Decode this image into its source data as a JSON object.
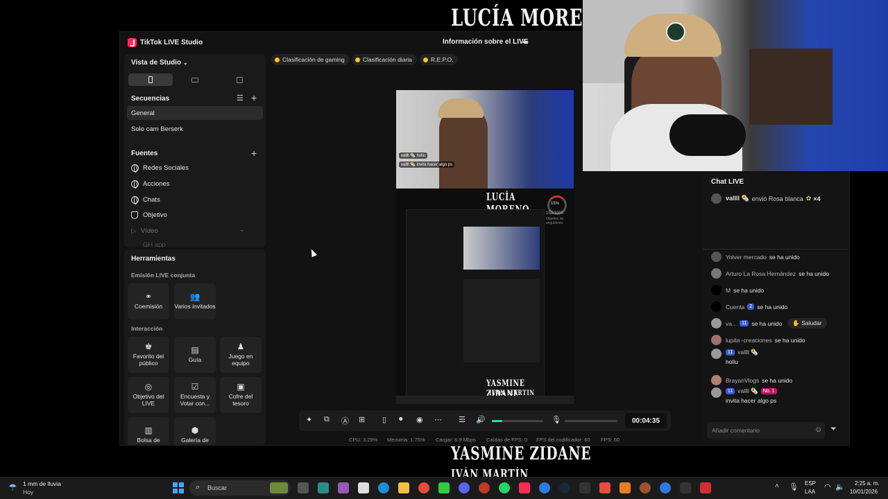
{
  "overlay": {
    "top_name": "LUCÍA MORENO",
    "bottom_name": "YASMINE ZIDANE",
    "bottom_name_2": "IVÁN MARTÍN"
  },
  "window": {
    "app_title": "TikTok LIVE Studio",
    "live_info": "Información sobre el LIVE"
  },
  "studio_view": {
    "label": "Vista de Studio"
  },
  "sequences": {
    "title": "Secuencias",
    "items": [
      "General",
      "Solo cam Berserk"
    ]
  },
  "sources": {
    "title": "Fuentes",
    "items": [
      "Redes Sociales",
      "Acciones",
      "Chats",
      "Objetivo",
      "Vídeo",
      "GH app"
    ]
  },
  "tools": {
    "title": "Herramientas",
    "section_joint": "Emisión LIVE conjunta",
    "joint_items": [
      "Coemisión",
      "Varios invitados"
    ],
    "section_interaction": "Interacción",
    "interaction_items": [
      "Favorito del público",
      "Guía",
      "Juego en equipo",
      "Objetivo del LIVE",
      "Encuesta y Votar con...",
      "Cofre del tesoro",
      "Bolsa de",
      "Galería de"
    ]
  },
  "tags": [
    "Clasificación de gaming",
    "Clasificación diaria",
    "R.E.P.O."
  ],
  "preview": {
    "top_name": "LUCÍA MORENO",
    "goal_percent": "15%",
    "goal_count": "153/1000",
    "goal_label": "Objetivo de seguidores",
    "bottom_name": "YASMINE ZIDANE",
    "bottom_name_2": "IVÁN MARTÍN",
    "chat_1": "vallll 🌯 holiu",
    "chat_2": "vallll 🌯 invita hacer algo ps"
  },
  "controls": {
    "timer": "00:04:35",
    "volume_level": 0.2
  },
  "stats": {
    "cpu": "CPU:  3.29%",
    "memory": "Memoria:  1.75%",
    "load": "Cargar:  6.9 Mbps",
    "fps_drop": "Caídas de FPS:  0",
    "encoder_fps": "FPS del codificador:  60",
    "fps": "FPS:  60"
  },
  "chat": {
    "title": "Chat LIVE",
    "gift": {
      "user": "vallll 🌯",
      "text": "envió Rosa blanca",
      "multiplier": "×4"
    },
    "messages": [
      {
        "user": "Yolver mercado",
        "text": "se ha unido"
      },
      {
        "user": "Arturo La Rosa Hernández",
        "text": "se ha unido"
      },
      {
        "user": "M",
        "text": "se ha unido"
      },
      {
        "user": "Cuenta",
        "level": "2",
        "text": "se ha unido"
      },
      {
        "user": "va...",
        "level": "11",
        "text": "se ha unido",
        "action": "Saludar"
      },
      {
        "user": "lupita -creaciones",
        "text": "se ha unido"
      },
      {
        "user": "vallll 🌯",
        "level": "11",
        "text": "holiu"
      },
      {
        "user": "BrayanVlogs",
        "text": "se ha unido"
      },
      {
        "user": "vallll 🌯",
        "level": "11",
        "badge": "No. 1",
        "text": "invita hacer algo ps"
      }
    ],
    "input_placeholder": "Añadir comentario"
  },
  "taskbar": {
    "weather_line1": "1 mm de lluvia",
    "weather_line2": "Hoy",
    "search": "Buscar",
    "lang_1": "ESP",
    "lang_2": "LAA",
    "time": "2:25 a. m.",
    "date": "10/01/2026"
  }
}
